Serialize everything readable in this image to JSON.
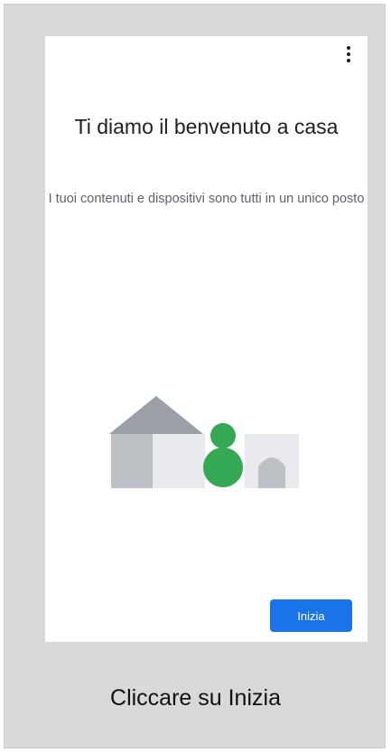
{
  "screen": {
    "title": "Ti diamo il benvenuto a casa",
    "subtitle": "I tuoi contenuti e dispositivi sono tutti in un unico posto",
    "start_button_label": "Inizia",
    "menu_icon": "more-vert-icon",
    "illustration": "home-illustration"
  },
  "caption": "Cliccare su Inizia",
  "colors": {
    "primary_button": "#1a73e8",
    "illustration_green": "#34a853",
    "illustration_gray_dark": "#9aa0a6",
    "illustration_gray_mid": "#bdc1c6",
    "illustration_gray_light": "#e8eaed",
    "frame_background": "#d9d9d9"
  }
}
